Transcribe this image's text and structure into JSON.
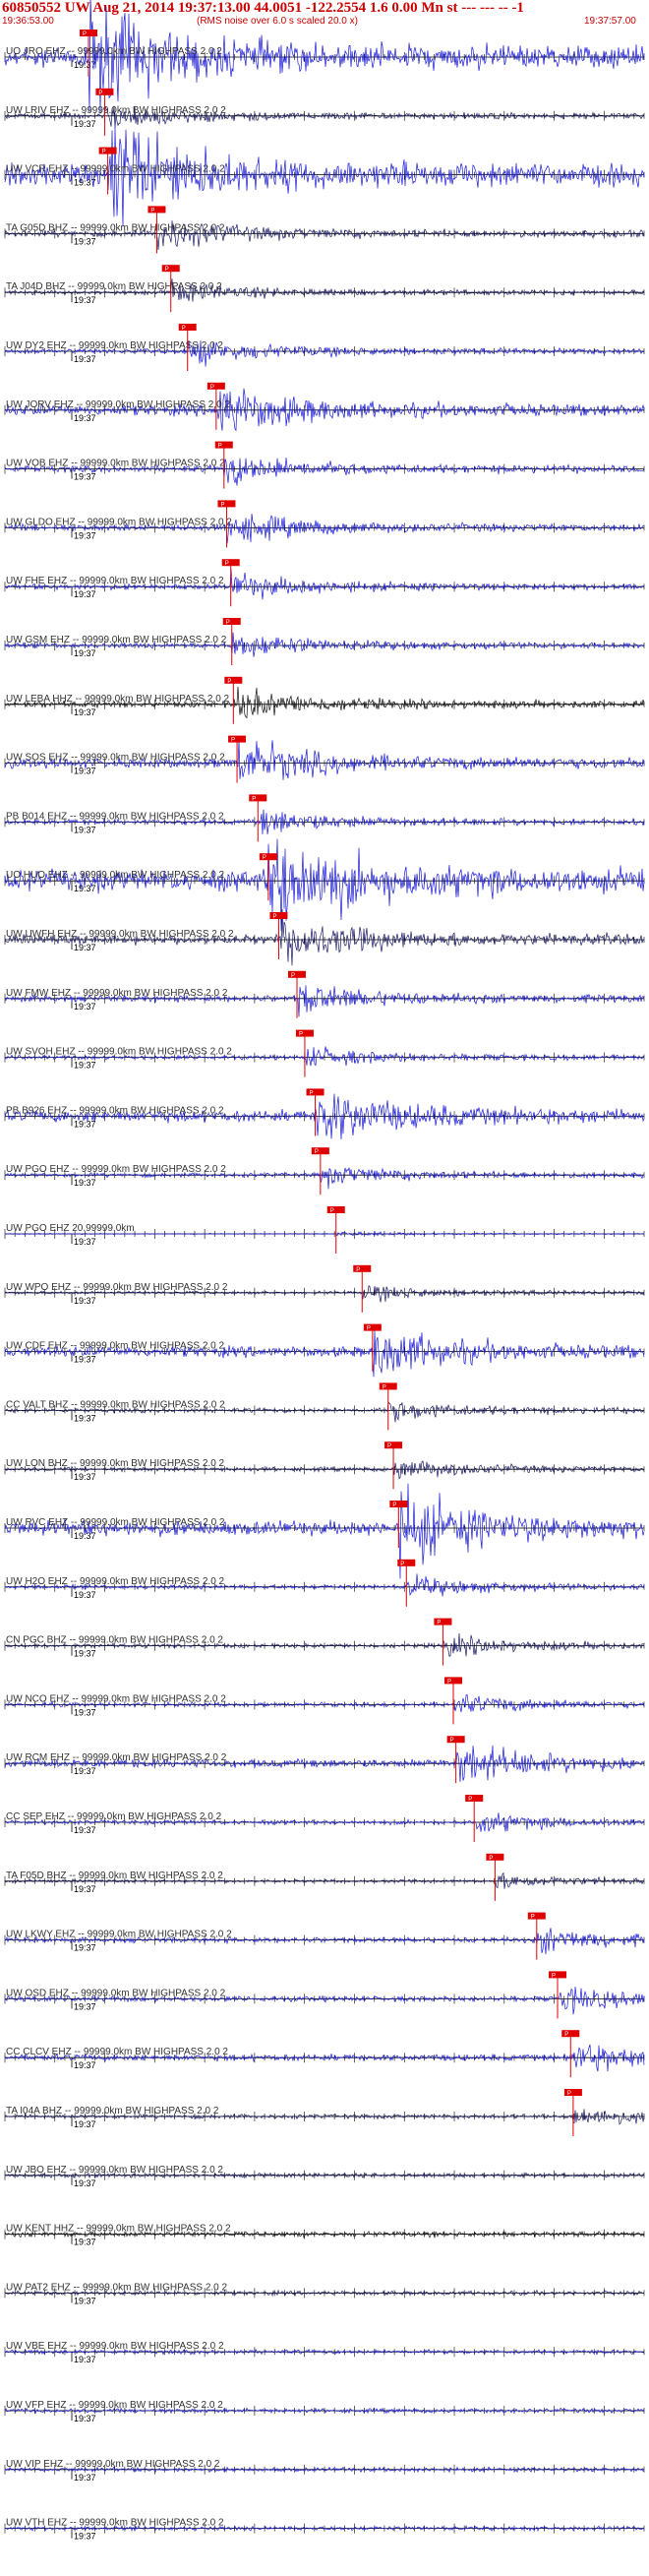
{
  "header": {
    "title": "60850552 UW Aug 21, 2014 19:37:13.00   44.0051 -122.2554  1.6 0.00 Mn st --- --- --  -1",
    "start_time": "19:36:53.00",
    "note": "(RMS noise over 6.0 s scaled 20.0 x)",
    "end_time": "19:37:57.00"
  },
  "minute_label": "19:37",
  "colors": {
    "blue": "#1a1ad6",
    "navy": "#1a1a66",
    "black": "#111111",
    "pick_red": "#e00000",
    "label": "#333333",
    "title_red": "#cc0000"
  },
  "channels": [
    {
      "label": "UO JRO EHZ -- 99999.0km BW  HIGHPASS  2.0  2",
      "color": "blue",
      "amp": 20,
      "pick": 0.0,
      "pick_label": "P"
    },
    {
      "label": "UW LRIV EHZ -- 99999.0km BW  HIGHPASS  2.0  2",
      "color": "navy",
      "amp": 5,
      "pick": 0.031,
      "pick_label": "P"
    },
    {
      "label": "UW VCR EHZ -- 99999.0km BW  HIGHPASS  2.0  2",
      "color": "blue",
      "amp": 20,
      "pick": 0.037,
      "pick_label": "P"
    },
    {
      "label": "TA G05D BHZ -- 99999.0km BW  HIGHPASS  2.0  2",
      "color": "navy",
      "amp": 6,
      "pick": 0.131,
      "pick_label": "P"
    },
    {
      "label": "TA J04D BHZ -- 99999.0km BW  HIGHPASS  2.0  2",
      "color": "navy",
      "amp": 4,
      "pick": 0.158,
      "pick_label": "P"
    },
    {
      "label": "UW DY2 EHZ -- 99999.0km BW  HIGHPASS  2.0  2",
      "color": "blue",
      "amp": 5,
      "pick": 0.19,
      "pick_label": "P"
    },
    {
      "label": "UW JORV EHZ -- 99999.0km BW  HIGHPASS  2.0  2",
      "color": "blue",
      "amp": 10,
      "pick": 0.245,
      "pick_label": "P"
    },
    {
      "label": "UW VOB EHZ -- 99999.0km BW  HIGHPASS  2.0  2",
      "color": "blue",
      "amp": 6,
      "pick": 0.26,
      "pick_label": "P"
    },
    {
      "label": "UW GLDO EHZ -- 99999.0km BW  HIGHPASS  2.0  2",
      "color": "blue",
      "amp": 6,
      "pick": 0.265,
      "pick_label": "P"
    },
    {
      "label": "UW FHE EHZ -- 99999.0km BW  HIGHPASS  2.0  2",
      "color": "blue",
      "amp": 5,
      "pick": 0.273,
      "pick_label": "P"
    },
    {
      "label": "UW GSM EHZ -- 99999.0km BW  HIGHPASS  2.0  2",
      "color": "blue",
      "amp": 5,
      "pick": 0.275,
      "pick_label": "P"
    },
    {
      "label": "UW LEBA HHZ -- 99999.0km BW  HIGHPASS  2.0  2",
      "color": "black",
      "amp": 6,
      "pick": 0.278,
      "pick_label": "P"
    },
    {
      "label": "UW SOS EHZ -- 99999.0km BW  HIGHPASS  2.0  2",
      "color": "blue",
      "amp": 9,
      "pick": 0.285,
      "pick_label": "P"
    },
    {
      "label": "PB B014 EHZ -- 99999.0km BW  HIGHPASS  2.0  2",
      "color": "blue",
      "amp": 5,
      "pick": 0.325,
      "pick_label": "P"
    },
    {
      "label": "UO HUO EHZ -- 99999.0km BW  HIGHPASS  2.0  2",
      "color": "blue",
      "amp": 20,
      "pick": 0.345,
      "pick_label": "P"
    },
    {
      "label": "UW UWFH EHZ -- 99999.0km BW  HIGHPASS  2.0  2",
      "color": "navy",
      "amp": 9,
      "pick": 0.365,
      "pick_label": "P"
    },
    {
      "label": "UW FMW EHZ -- 99999.0km BW  HIGHPASS  2.0  2",
      "color": "blue",
      "amp": 6,
      "pick": 0.4,
      "pick_label": "P"
    },
    {
      "label": "UW SVOH EHZ -- 99999.0km BW  HIGHPASS  2.0  2",
      "color": "blue",
      "amp": 4,
      "pick": 0.415,
      "pick_label": "P"
    },
    {
      "label": "PB B926 EHZ -- 99999.0km BW  HIGHPASS  2.0  2",
      "color": "blue",
      "amp": 11,
      "pick": 0.435,
      "pick_label": "P"
    },
    {
      "label": "UW PGO EHZ -- 99999.0km BW  HIGHPASS  2.0  2",
      "color": "blue",
      "amp": 4,
      "pick": 0.445,
      "pick_label": "P"
    },
    {
      "label": "UW PGO EHZ 20.99999.0km",
      "color": "blue",
      "amp": 1,
      "pick": 0.475,
      "pick_label": "P"
    },
    {
      "label": "UW WPO EHZ -- 99999.0km BW  HIGHPASS  2.0  2",
      "color": "navy",
      "amp": 3,
      "pick": 0.525,
      "pick_label": "P"
    },
    {
      "label": "UW CDF EHZ -- 99999.0km BW  HIGHPASS  2.0  2",
      "color": "blue",
      "amp": 10,
      "pick": 0.545,
      "pick_label": "P"
    },
    {
      "label": "CC VALT BHZ -- 99999.0km BW  HIGHPASS  2.0  2",
      "color": "navy",
      "amp": 4,
      "pick": 0.575,
      "pick_label": "P"
    },
    {
      "label": "UW LON BHZ -- 99999.0km BW  HIGHPASS  2.0  2",
      "color": "navy",
      "amp": 4,
      "pick": 0.585,
      "pick_label": "P"
    },
    {
      "label": "UW RVC EHZ -- 99999.0km BW  HIGHPASS  2.0  2",
      "color": "blue",
      "amp": 14,
      "pick": 0.595,
      "pick_label": "P"
    },
    {
      "label": "UW H2O EHZ -- 99999.0km BW  HIGHPASS  2.0  2",
      "color": "blue",
      "amp": 4,
      "pick": 0.61,
      "pick_label": "P"
    },
    {
      "label": "CN PGC BHZ -- 99999.0km BW  HIGHPASS  2.0  2",
      "color": "navy",
      "amp": 4,
      "pick": 0.68,
      "pick_label": "P"
    },
    {
      "label": "UW NCO EHZ -- 99999.0km BW  HIGHPASS  2.0  2",
      "color": "blue",
      "amp": 4,
      "pick": 0.7,
      "pick_label": "P"
    },
    {
      "label": "UW RCM EHZ -- 99999.0km BW  HIGHPASS  2.0  2",
      "color": "blue",
      "amp": 8,
      "pick": 0.705,
      "pick_label": "P"
    },
    {
      "label": "CC SEP EHZ -- 99999.0km BW  HIGHPASS  2.0  2",
      "color": "blue",
      "amp": 4,
      "pick": 0.74,
      "pick_label": "P"
    },
    {
      "label": "TA F05D BHZ -- 99999.0km BW  HIGHPASS  2.0  2",
      "color": "navy",
      "amp": 3,
      "pick": 0.78,
      "pick_label": "P"
    },
    {
      "label": "UW LKWY EHZ -- 99999.0km BW  HIGHPASS  2.0  2",
      "color": "blue",
      "amp": 5,
      "pick": 0.86,
      "pick_label": "P"
    },
    {
      "label": "UW OSD EHZ -- 99999.0km BW  HIGHPASS  2.0  2",
      "color": "blue",
      "amp": 5,
      "pick": 0.9,
      "pick_label": "P"
    },
    {
      "label": "CC CLCV EHZ -- 99999.0km BW  HIGHPASS  2.0  2",
      "color": "blue",
      "amp": 6,
      "pick": 0.925,
      "pick_label": "P"
    },
    {
      "label": "TA I04A BHZ -- 99999.0km BW  HIGHPASS  2.0  2",
      "color": "navy",
      "amp": 4,
      "pick": 0.93,
      "pick_label": "P"
    },
    {
      "label": "UW JBO EHZ -- 99999.0km BW  HIGHPASS  2.0  2",
      "color": "navy",
      "amp": 4,
      "pick": null
    },
    {
      "label": "UW KENT HHZ -- 99999.0km BW  HIGHPASS  2.0  2",
      "color": "black",
      "amp": 5,
      "pick": null
    },
    {
      "label": "UW PAT2 EHZ -- 99999.0km BW  HIGHPASS  2.0  2",
      "color": "navy",
      "amp": 4,
      "pick": null
    },
    {
      "label": "UW VBE EHZ -- 99999.0km BW  HIGHPASS  2.0  2",
      "color": "blue",
      "amp": 4,
      "pick": null
    },
    {
      "label": "UW VFP EHZ -- 99999.0km BW  HIGHPASS  2.0  2",
      "color": "blue",
      "amp": 4,
      "pick": null
    },
    {
      "label": "UW VIP EHZ -- 99999.0km BW  HIGHPASS  2.0  2",
      "color": "blue",
      "amp": 4,
      "pick": null
    },
    {
      "label": "UW VTH EHZ -- 99999.0km BW  HIGHPASS  2.0  2",
      "color": "blue",
      "amp": 4,
      "pick": null
    }
  ]
}
